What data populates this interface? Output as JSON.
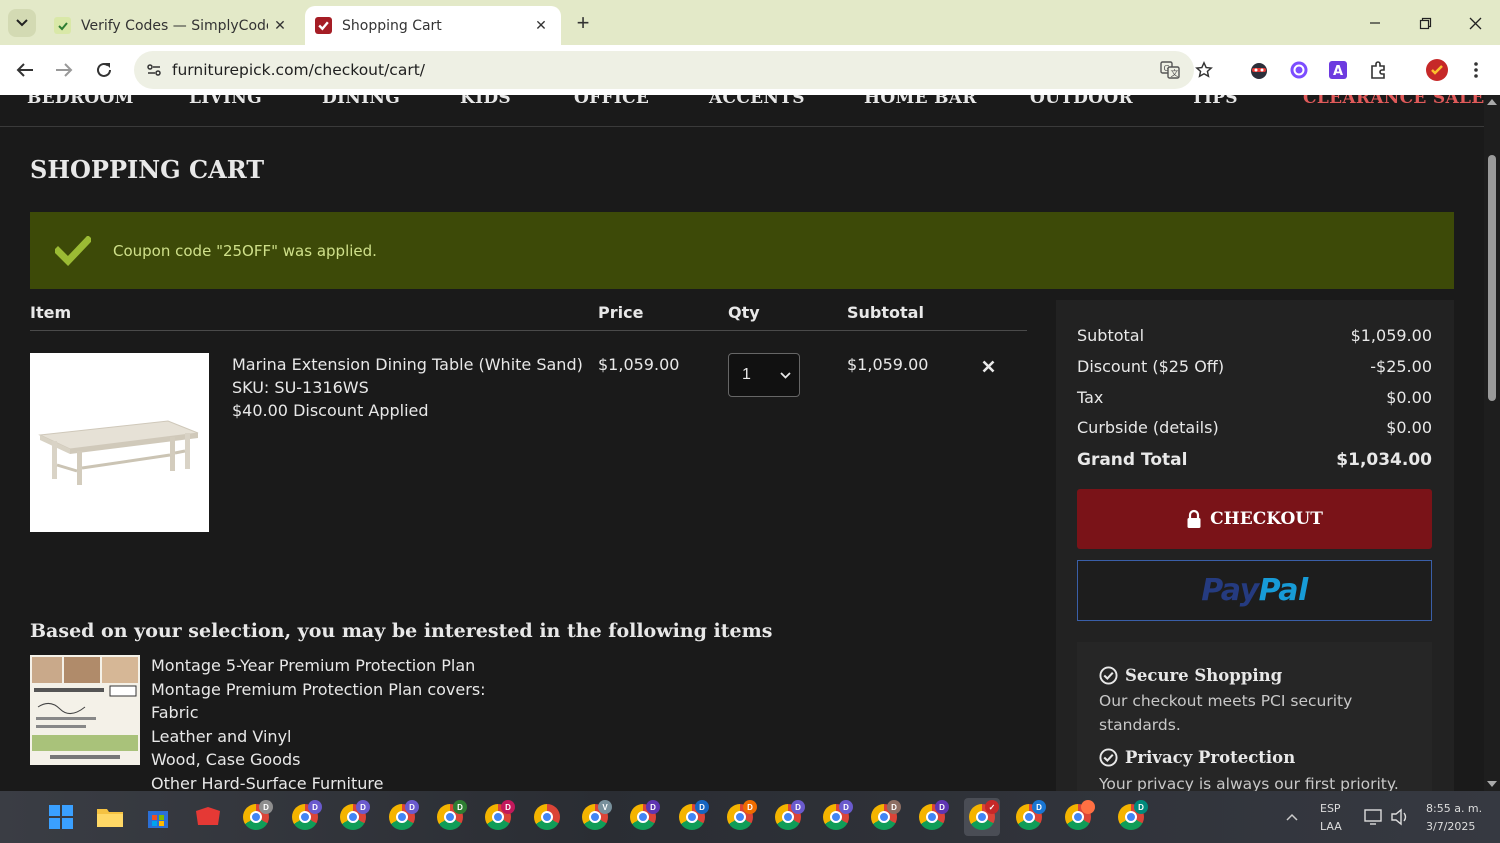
{
  "browser": {
    "tabs": [
      {
        "title": "Verify Codes — SimplyCodes",
        "active": false
      },
      {
        "title": "Shopping Cart",
        "active": true
      }
    ],
    "url": "furniturepick.com/checkout/cart/"
  },
  "nav": {
    "items": [
      "BEDROOM",
      "LIVING",
      "DINING",
      "KIDS",
      "OFFICE",
      "ACCENTS",
      "HOME BAR",
      "OUTDOOR",
      "TIPS",
      "CLEARANCE SALE"
    ]
  },
  "page": {
    "title": "SHOPPING CART",
    "notice": "Coupon code \"25OFF\" was applied."
  },
  "cart": {
    "headers": {
      "item": "Item",
      "price": "Price",
      "qty": "Qty",
      "subtotal": "Subtotal"
    },
    "item": {
      "name": "Marina Extension Dining Table (White Sand)",
      "sku": "SKU: SU-1316WS",
      "discount_note": "$40.00 Discount Applied",
      "price": "$1,059.00",
      "qty": "1",
      "subtotal": "$1,059.00"
    }
  },
  "recommend": {
    "title": "Based on your selection, you may be interested in the following items",
    "lines": [
      "Montage 5-Year Premium Protection Plan",
      "Montage Premium Protection Plan covers:",
      "Fabric",
      "Leather and Vinyl",
      "Wood, Case Goods",
      "Other Hard-Surface Furniture"
    ]
  },
  "summary": {
    "rows": [
      {
        "label": "Subtotal",
        "value": "$1,059.00"
      },
      {
        "label": "Discount ($25 Off)",
        "value": "-$25.00"
      },
      {
        "label": "Tax",
        "value": "$0.00"
      },
      {
        "label": "Curbside (details)",
        "value": "$0.00"
      }
    ],
    "grand_total": {
      "label": "Grand Total",
      "value": "$1,034.00"
    },
    "checkout_label": "CHECKOUT",
    "paypal_a": "Pay",
    "paypal_b": "Pal",
    "trust": [
      {
        "title": "Secure Shopping",
        "text": "Our checkout meets PCI security standards."
      },
      {
        "title": "Privacy Protection",
        "text": "Your privacy is always our first priority."
      }
    ]
  },
  "taskbar": {
    "lang": "ESP",
    "lang2": "LAA",
    "time": "8:55 a. m.",
    "date": "3/7/2025"
  },
  "colors": {
    "notice_bg": "#3d4a08",
    "notice_text": "#cfe08a",
    "checkout_bg": "#7a1318",
    "sale_text": "#e05a5a"
  }
}
